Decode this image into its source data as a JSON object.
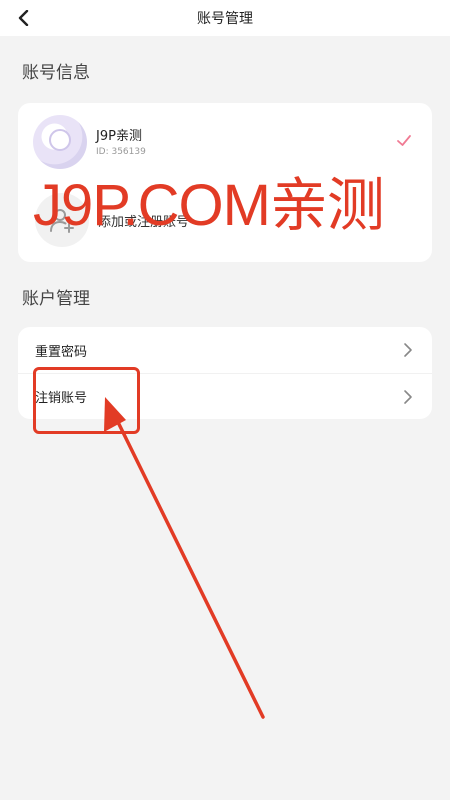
{
  "header": {
    "title": "账号管理",
    "back_icon": "chevron-left-icon"
  },
  "account_info": {
    "section_title": "账号信息",
    "current_account": {
      "name": "J9P亲测",
      "id_text": "ID: 356139",
      "selected": true
    },
    "add_account_label": "添加或注册账号"
  },
  "account_management": {
    "section_title": "账户管理",
    "items": [
      {
        "label": "重置密码"
      },
      {
        "label": "注销账号"
      }
    ]
  },
  "overlay": {
    "watermark_text": "J9P.COM亲测",
    "color": "#e23b25"
  },
  "colors": {
    "check": "#f07a93",
    "background": "#f3f3f3"
  }
}
